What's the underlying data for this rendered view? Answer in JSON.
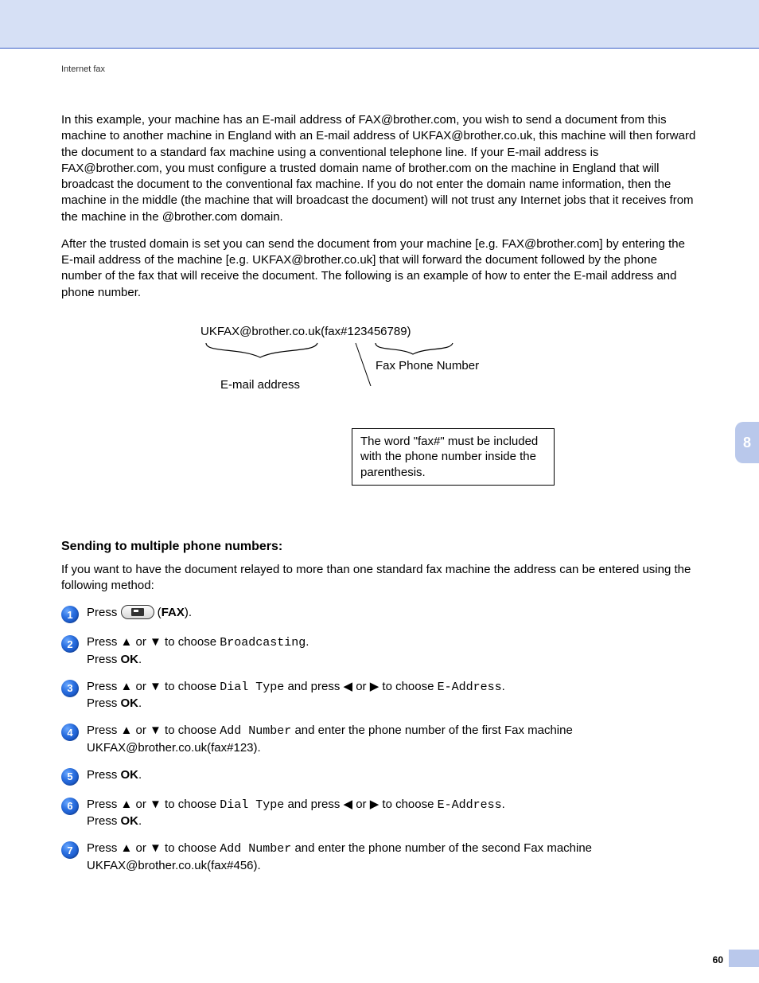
{
  "header": {
    "section_label": "Internet fax"
  },
  "paragraphs": {
    "p1": "In this example, your machine has an E-mail address of FAX@brother.com, you wish to send a document from this machine to another machine in England with an E-mail address of UKFAX@brother.co.uk, this machine will then forward the document to a standard fax machine using a conventional telephone line. If your E-mail address is FAX@brother.com, you must configure a trusted domain name of brother.com on the machine in England that will broadcast the document to the conventional fax machine. If you do not enter the domain name information, then the machine in the middle (the machine that will broadcast the document) will not trust any Internet jobs that it receives from the machine in the @brother.com domain.",
    "p2": "After the trusted domain is set you can send the document from your machine [e.g. FAX@brother.com] by entering the E-mail address of the machine [e.g. UKFAX@brother.co.uk] that will forward the document followed by the phone number of the fax that will receive the document. The following is an example of how to enter the E-mail address and phone number."
  },
  "diagram": {
    "example_string": "UKFAX@brother.co.uk(fax#123456789)",
    "label_email": "E-mail address",
    "label_faxnum": "Fax Phone Number",
    "note": "The word \"fax#\" must be included with the phone number inside the parenthesis."
  },
  "subsection": {
    "heading": "Sending to multiple phone numbers:",
    "intro": "If you want to have the document relayed to more than one standard fax machine the address can be entered using the following method:"
  },
  "steps": {
    "s1": {
      "num": "1",
      "pre": "Press ",
      "button_label": "FAX",
      "post": ")."
    },
    "s2": {
      "num": "2",
      "l1a": "Press ▲ or ▼ to choose ",
      "l1b": "Broadcasting",
      "l1c": ".",
      "l2a": "Press ",
      "l2b": "OK",
      "l2c": "."
    },
    "s3": {
      "num": "3",
      "l1a": "Press ▲ or ▼ to choose ",
      "l1b": "Dial Type",
      "l1c": " and press ◀ or ▶ to choose ",
      "l1d": "E-Address",
      "l1e": ".",
      "l2a": "Press ",
      "l2b": "OK",
      "l2c": "."
    },
    "s4": {
      "num": "4",
      "l1a": "Press ▲ or ▼ to choose ",
      "l1b": "Add Number",
      "l1c": " and enter the phone number of the first Fax machine UKFAX@brother.co.uk(fax#123)."
    },
    "s5": {
      "num": "5",
      "l1a": "Press ",
      "l1b": "OK",
      "l1c": "."
    },
    "s6": {
      "num": "6",
      "l1a": "Press ▲ or ▼ to choose ",
      "l1b": "Dial Type",
      "l1c": " and press ◀ or ▶ to choose ",
      "l1d": "E-Address",
      "l1e": ".",
      "l2a": "Press ",
      "l2b": "OK",
      "l2c": "."
    },
    "s7": {
      "num": "7",
      "l1a": "Press ▲ or ▼ to choose ",
      "l1b": "Add Number",
      "l1c": " and enter the phone number of the second Fax machine UKFAX@brother.co.uk(fax#456)."
    }
  },
  "chrome": {
    "side_tab": "8",
    "page_number": "60"
  }
}
